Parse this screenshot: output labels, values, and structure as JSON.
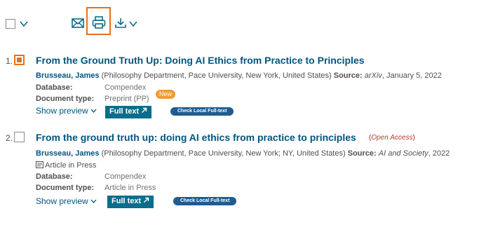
{
  "colors": {
    "accent": "#e9711c",
    "link": "#005580",
    "fulltext_button": "#0a6d8c",
    "local_button": "#1f5c93",
    "badge_new": "#f29a36",
    "open_access": "#c0392b"
  },
  "toolbar": {
    "icons": [
      "select-all-checkbox",
      "chevron-down-icon",
      "mail-icon",
      "printer-icon",
      "download-icon",
      "chevron-down-icon"
    ]
  },
  "results": [
    {
      "number": "1.",
      "checked": true,
      "title": "From the Ground Truth Up: Doing AI Ethics from Practice to Principles",
      "author": "Brusseau, James",
      "affiliation": "(Philosophy Department, Pace University, New York, United States)",
      "source_label": "Source:",
      "source_name": "arXiv",
      "source_rest": ", January 5, 2022",
      "database_label": "Database:",
      "database": "Compendex",
      "doctype_label": "Document type:",
      "doctype": "Preprint (PP)",
      "badge": "New",
      "show_preview": "Show preview",
      "fulltext": "Full text",
      "local": "Check Local Full-text"
    },
    {
      "number": "2.",
      "checked": false,
      "title": "From the ground truth up: doing AI ethics from practice to principles",
      "open_access": "Open Access",
      "author": "Brusseau, James",
      "affiliation": "(Philosophy Department, Pace University, New York; NY, United States)",
      "source_label": "Source:",
      "source_name": "AI and Society",
      "source_rest": ", 2022",
      "article_in_press": "Article in Press",
      "database_label": "Database:",
      "database": "Compendex",
      "doctype_label": "Document type:",
      "doctype": "Article in Press",
      "show_preview": "Show preview",
      "fulltext": "Full text",
      "local": "Check Local Full-text"
    }
  ]
}
